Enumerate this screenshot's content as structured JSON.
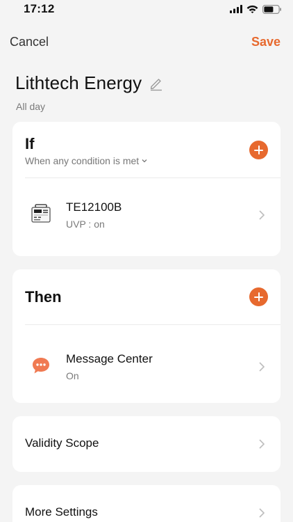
{
  "status_bar": {
    "time": "17:12"
  },
  "nav": {
    "cancel_label": "Cancel",
    "save_label": "Save"
  },
  "scene": {
    "title": "Lithtech Energy",
    "subtitle": "All day"
  },
  "if_section": {
    "title": "If",
    "condition_mode": "When any condition is met",
    "condition": {
      "device_name": "TE12100B",
      "state": "UVP : on",
      "icon": "battery-device-icon"
    }
  },
  "then_section": {
    "title": "Then",
    "action": {
      "name": "Message Center",
      "state": "On",
      "icon": "message-bubble-icon"
    }
  },
  "validity": {
    "label": "Validity Scope"
  },
  "more_settings": {
    "label": "More Settings"
  },
  "colors": {
    "accent": "#e7692e",
    "background": "#f4f4f4",
    "card": "#ffffff"
  }
}
